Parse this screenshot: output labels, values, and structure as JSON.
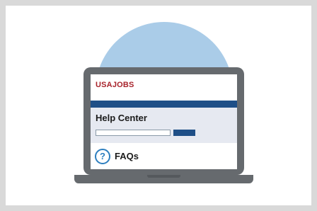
{
  "screen": {
    "brand": "USAJOBS",
    "help_center_title": "Help Center",
    "faq_icon_glyph": "?",
    "faq_label": "FAQs"
  },
  "colors": {
    "frame_background": "#d9d9d9",
    "circle": "#aacce8",
    "laptop": "#666a6e",
    "brand": "#a8232b",
    "navbar": "#1f4f87",
    "help_panel": "#e6e9f1",
    "faq_icon": "#2e7fbf"
  }
}
